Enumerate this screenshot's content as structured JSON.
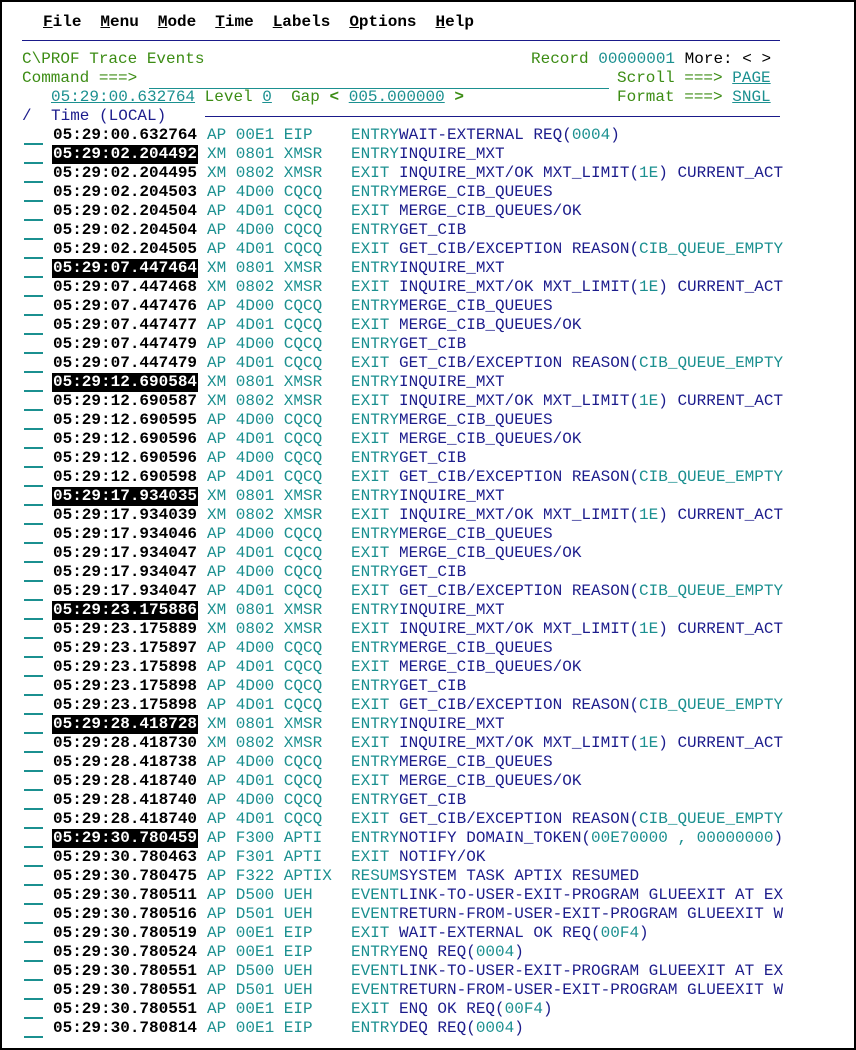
{
  "menu": [
    {
      "key": "F",
      "rest": "ile"
    },
    {
      "key": "M",
      "rest": "enu"
    },
    {
      "key": "M",
      "rest": "ode"
    },
    {
      "key": "T",
      "rest": "ime"
    },
    {
      "key": "L",
      "rest": "abels"
    },
    {
      "key": "O",
      "rest": "ptions"
    },
    {
      "key": "H",
      "rest": "elp"
    }
  ],
  "header": {
    "title": "C\\PROF Trace Events",
    "record_label": "Record",
    "record_value": "00000001",
    "more_label": "More:",
    "more_arrows": "< >",
    "command_label": "Command ===>",
    "command_value": "",
    "scroll_label": "Scroll ===>",
    "scroll_value": "PAGE",
    "format_label": "Format ===>",
    "format_value": "SNGL",
    "start_time": "05:29:00.632764",
    "level_label": "Level",
    "level_value": "0",
    "gap_label": "Gap",
    "gap_prev": "<",
    "gap_value": "005.000000",
    "gap_next": ">",
    "slash": "/",
    "time_header": "Time (LOCAL)"
  },
  "colors": {
    "label": "#3c8c14",
    "value": "#1b9090",
    "text": "#1c1c8c",
    "highlight_bg": "#000000"
  },
  "rows": [
    {
      "time": "05:29:00.632764",
      "hl": false,
      "comp": "AP",
      "code": "00E1",
      "mod": "EIP",
      "point": "ENTRY",
      "desc": [
        "WAIT-EXTERNAL REQ(",
        "0004",
        ")"
      ]
    },
    {
      "time": "05:29:02.204492",
      "hl": true,
      "comp": "XM",
      "code": "0801",
      "mod": "XMSR",
      "point": "ENTRY",
      "desc": [
        "INQUIRE_MXT"
      ]
    },
    {
      "time": "05:29:02.204495",
      "hl": false,
      "comp": "XM",
      "code": "0802",
      "mod": "XMSR",
      "point": "EXIT",
      "desc": [
        "INQUIRE_MXT/OK MXT_LIMIT(",
        "1E",
        ") CURRENT_ACT"
      ]
    },
    {
      "time": "05:29:02.204503",
      "hl": false,
      "comp": "AP",
      "code": "4D00",
      "mod": "CQCQ",
      "point": "ENTRY",
      "desc": [
        "MERGE_CIB_QUEUES"
      ]
    },
    {
      "time": "05:29:02.204504",
      "hl": false,
      "comp": "AP",
      "code": "4D01",
      "mod": "CQCQ",
      "point": "EXIT",
      "desc": [
        "MERGE_CIB_QUEUES/OK"
      ]
    },
    {
      "time": "05:29:02.204504",
      "hl": false,
      "comp": "AP",
      "code": "4D00",
      "mod": "CQCQ",
      "point": "ENTRY",
      "desc": [
        "GET_CIB"
      ]
    },
    {
      "time": "05:29:02.204505",
      "hl": false,
      "comp": "AP",
      "code": "4D01",
      "mod": "CQCQ",
      "point": "EXIT",
      "desc": [
        "GET_CIB/EXCEPTION REASON(",
        "CIB_QUEUE_EMPTY"
      ]
    },
    {
      "time": "05:29:07.447464",
      "hl": true,
      "comp": "XM",
      "code": "0801",
      "mod": "XMSR",
      "point": "ENTRY",
      "desc": [
        "INQUIRE_MXT"
      ]
    },
    {
      "time": "05:29:07.447468",
      "hl": false,
      "comp": "XM",
      "code": "0802",
      "mod": "XMSR",
      "point": "EXIT",
      "desc": [
        "INQUIRE_MXT/OK MXT_LIMIT(",
        "1E",
        ") CURRENT_ACT"
      ]
    },
    {
      "time": "05:29:07.447476",
      "hl": false,
      "comp": "AP",
      "code": "4D00",
      "mod": "CQCQ",
      "point": "ENTRY",
      "desc": [
        "MERGE_CIB_QUEUES"
      ]
    },
    {
      "time": "05:29:07.447477",
      "hl": false,
      "comp": "AP",
      "code": "4D01",
      "mod": "CQCQ",
      "point": "EXIT",
      "desc": [
        "MERGE_CIB_QUEUES/OK"
      ]
    },
    {
      "time": "05:29:07.447479",
      "hl": false,
      "comp": "AP",
      "code": "4D00",
      "mod": "CQCQ",
      "point": "ENTRY",
      "desc": [
        "GET_CIB"
      ]
    },
    {
      "time": "05:29:07.447479",
      "hl": false,
      "comp": "AP",
      "code": "4D01",
      "mod": "CQCQ",
      "point": "EXIT",
      "desc": [
        "GET_CIB/EXCEPTION REASON(",
        "CIB_QUEUE_EMPTY"
      ]
    },
    {
      "time": "05:29:12.690584",
      "hl": true,
      "comp": "XM",
      "code": "0801",
      "mod": "XMSR",
      "point": "ENTRY",
      "desc": [
        "INQUIRE_MXT"
      ]
    },
    {
      "time": "05:29:12.690587",
      "hl": false,
      "comp": "XM",
      "code": "0802",
      "mod": "XMSR",
      "point": "EXIT",
      "desc": [
        "INQUIRE_MXT/OK MXT_LIMIT(",
        "1E",
        ") CURRENT_ACT"
      ]
    },
    {
      "time": "05:29:12.690595",
      "hl": false,
      "comp": "AP",
      "code": "4D00",
      "mod": "CQCQ",
      "point": "ENTRY",
      "desc": [
        "MERGE_CIB_QUEUES"
      ]
    },
    {
      "time": "05:29:12.690596",
      "hl": false,
      "comp": "AP",
      "code": "4D01",
      "mod": "CQCQ",
      "point": "EXIT",
      "desc": [
        "MERGE_CIB_QUEUES/OK"
      ]
    },
    {
      "time": "05:29:12.690596",
      "hl": false,
      "comp": "AP",
      "code": "4D00",
      "mod": "CQCQ",
      "point": "ENTRY",
      "desc": [
        "GET_CIB"
      ]
    },
    {
      "time": "05:29:12.690598",
      "hl": false,
      "comp": "AP",
      "code": "4D01",
      "mod": "CQCQ",
      "point": "EXIT",
      "desc": [
        "GET_CIB/EXCEPTION REASON(",
        "CIB_QUEUE_EMPTY"
      ]
    },
    {
      "time": "05:29:17.934035",
      "hl": true,
      "comp": "XM",
      "code": "0801",
      "mod": "XMSR",
      "point": "ENTRY",
      "desc": [
        "INQUIRE_MXT"
      ]
    },
    {
      "time": "05:29:17.934039",
      "hl": false,
      "comp": "XM",
      "code": "0802",
      "mod": "XMSR",
      "point": "EXIT",
      "desc": [
        "INQUIRE_MXT/OK MXT_LIMIT(",
        "1E",
        ") CURRENT_ACT"
      ]
    },
    {
      "time": "05:29:17.934046",
      "hl": false,
      "comp": "AP",
      "code": "4D00",
      "mod": "CQCQ",
      "point": "ENTRY",
      "desc": [
        "MERGE_CIB_QUEUES"
      ]
    },
    {
      "time": "05:29:17.934047",
      "hl": false,
      "comp": "AP",
      "code": "4D01",
      "mod": "CQCQ",
      "point": "EXIT",
      "desc": [
        "MERGE_CIB_QUEUES/OK"
      ]
    },
    {
      "time": "05:29:17.934047",
      "hl": false,
      "comp": "AP",
      "code": "4D00",
      "mod": "CQCQ",
      "point": "ENTRY",
      "desc": [
        "GET_CIB"
      ]
    },
    {
      "time": "05:29:17.934047",
      "hl": false,
      "comp": "AP",
      "code": "4D01",
      "mod": "CQCQ",
      "point": "EXIT",
      "desc": [
        "GET_CIB/EXCEPTION REASON(",
        "CIB_QUEUE_EMPTY"
      ]
    },
    {
      "time": "05:29:23.175886",
      "hl": true,
      "comp": "XM",
      "code": "0801",
      "mod": "XMSR",
      "point": "ENTRY",
      "desc": [
        "INQUIRE_MXT"
      ]
    },
    {
      "time": "05:29:23.175889",
      "hl": false,
      "comp": "XM",
      "code": "0802",
      "mod": "XMSR",
      "point": "EXIT",
      "desc": [
        "INQUIRE_MXT/OK MXT_LIMIT(",
        "1E",
        ") CURRENT_ACT"
      ]
    },
    {
      "time": "05:29:23.175897",
      "hl": false,
      "comp": "AP",
      "code": "4D00",
      "mod": "CQCQ",
      "point": "ENTRY",
      "desc": [
        "MERGE_CIB_QUEUES"
      ]
    },
    {
      "time": "05:29:23.175898",
      "hl": false,
      "comp": "AP",
      "code": "4D01",
      "mod": "CQCQ",
      "point": "EXIT",
      "desc": [
        "MERGE_CIB_QUEUES/OK"
      ]
    },
    {
      "time": "05:29:23.175898",
      "hl": false,
      "comp": "AP",
      "code": "4D00",
      "mod": "CQCQ",
      "point": "ENTRY",
      "desc": [
        "GET_CIB"
      ]
    },
    {
      "time": "05:29:23.175898",
      "hl": false,
      "comp": "AP",
      "code": "4D01",
      "mod": "CQCQ",
      "point": "EXIT",
      "desc": [
        "GET_CIB/EXCEPTION REASON(",
        "CIB_QUEUE_EMPTY"
      ]
    },
    {
      "time": "05:29:28.418728",
      "hl": true,
      "comp": "XM",
      "code": "0801",
      "mod": "XMSR",
      "point": "ENTRY",
      "desc": [
        "INQUIRE_MXT"
      ]
    },
    {
      "time": "05:29:28.418730",
      "hl": false,
      "comp": "XM",
      "code": "0802",
      "mod": "XMSR",
      "point": "EXIT",
      "desc": [
        "INQUIRE_MXT/OK MXT_LIMIT(",
        "1E",
        ") CURRENT_ACT"
      ]
    },
    {
      "time": "05:29:28.418738",
      "hl": false,
      "comp": "AP",
      "code": "4D00",
      "mod": "CQCQ",
      "point": "ENTRY",
      "desc": [
        "MERGE_CIB_QUEUES"
      ]
    },
    {
      "time": "05:29:28.418740",
      "hl": false,
      "comp": "AP",
      "code": "4D01",
      "mod": "CQCQ",
      "point": "EXIT",
      "desc": [
        "MERGE_CIB_QUEUES/OK"
      ]
    },
    {
      "time": "05:29:28.418740",
      "hl": false,
      "comp": "AP",
      "code": "4D00",
      "mod": "CQCQ",
      "point": "ENTRY",
      "desc": [
        "GET_CIB"
      ]
    },
    {
      "time": "05:29:28.418740",
      "hl": false,
      "comp": "AP",
      "code": "4D01",
      "mod": "CQCQ",
      "point": "EXIT",
      "desc": [
        "GET_CIB/EXCEPTION REASON(",
        "CIB_QUEUE_EMPTY"
      ]
    },
    {
      "time": "05:29:30.780459",
      "hl": true,
      "comp": "AP",
      "code": "F300",
      "mod": "APTI",
      "point": "ENTRY",
      "desc": [
        "NOTIFY DOMAIN_TOKEN(",
        "00E70000 , 00000000",
        ")"
      ]
    },
    {
      "time": "05:29:30.780463",
      "hl": false,
      "comp": "AP",
      "code": "F301",
      "mod": "APTI",
      "point": "EXIT",
      "desc": [
        "NOTIFY/OK"
      ]
    },
    {
      "time": "05:29:30.780475",
      "hl": false,
      "comp": "AP",
      "code": "F322",
      "mod": "APTIX",
      "point": "RESUM",
      "desc": [
        "SYSTEM TASK APTIX RESUMED"
      ]
    },
    {
      "time": "05:29:30.780511",
      "hl": false,
      "comp": "AP",
      "code": "D500",
      "mod": "UEH",
      "point": "EVENT",
      "desc": [
        "LINK-TO-USER-EXIT-PROGRAM GLUEEXIT AT EX"
      ]
    },
    {
      "time": "05:29:30.780516",
      "hl": false,
      "comp": "AP",
      "code": "D501",
      "mod": "UEH",
      "point": "EVENT",
      "desc": [
        "RETURN-FROM-USER-EXIT-PROGRAM GLUEEXIT W"
      ]
    },
    {
      "time": "05:29:30.780519",
      "hl": false,
      "comp": "AP",
      "code": "00E1",
      "mod": "EIP",
      "point": "EXIT",
      "desc": [
        "WAIT-EXTERNAL OK REQ(",
        "00F4",
        ")"
      ]
    },
    {
      "time": "05:29:30.780524",
      "hl": false,
      "comp": "AP",
      "code": "00E1",
      "mod": "EIP",
      "point": "ENTRY",
      "desc": [
        "ENQ REQ(",
        "0004",
        ")"
      ]
    },
    {
      "time": "05:29:30.780551",
      "hl": false,
      "comp": "AP",
      "code": "D500",
      "mod": "UEH",
      "point": "EVENT",
      "desc": [
        "LINK-TO-USER-EXIT-PROGRAM GLUEEXIT AT EX"
      ]
    },
    {
      "time": "05:29:30.780551",
      "hl": false,
      "comp": "AP",
      "code": "D501",
      "mod": "UEH",
      "point": "EVENT",
      "desc": [
        "RETURN-FROM-USER-EXIT-PROGRAM GLUEEXIT W"
      ]
    },
    {
      "time": "05:29:30.780551",
      "hl": false,
      "comp": "AP",
      "code": "00E1",
      "mod": "EIP",
      "point": "EXIT",
      "desc": [
        "ENQ OK REQ(",
        "00F4",
        ")"
      ]
    },
    {
      "time": "05:29:30.780814",
      "hl": false,
      "comp": "AP",
      "code": "00E1",
      "mod": "EIP",
      "point": "ENTRY",
      "desc": [
        "DEQ REQ(",
        "0004",
        ")"
      ]
    }
  ]
}
